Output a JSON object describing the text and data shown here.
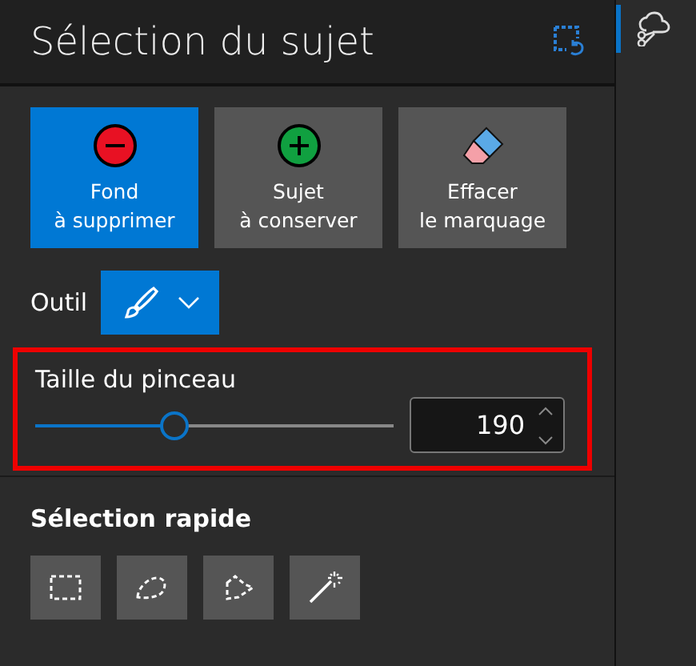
{
  "panel": {
    "title": "Sélection du sujet"
  },
  "mode_buttons": [
    {
      "kind": "remove",
      "lines": [
        "Fond",
        "à supprimer"
      ],
      "selected": true
    },
    {
      "kind": "add",
      "lines": [
        "Sujet",
        "à conserver"
      ],
      "selected": false
    },
    {
      "kind": "erase",
      "lines": [
        "Effacer",
        "le marquage"
      ],
      "selected": false
    }
  ],
  "tool": {
    "label": "Outil",
    "selected": true
  },
  "brush_size": {
    "label": "Taille du pinceau",
    "level": 0.39,
    "value": "190",
    "highlighted": true
  },
  "quick_selection": {
    "title": "Sélection rapide",
    "tools": [
      {
        "kind": "rectangle"
      },
      {
        "kind": "lasso"
      },
      {
        "kind": "polygon"
      },
      {
        "kind": "wand"
      }
    ]
  },
  "side_tabs": [
    {
      "selected": true
    }
  ]
}
